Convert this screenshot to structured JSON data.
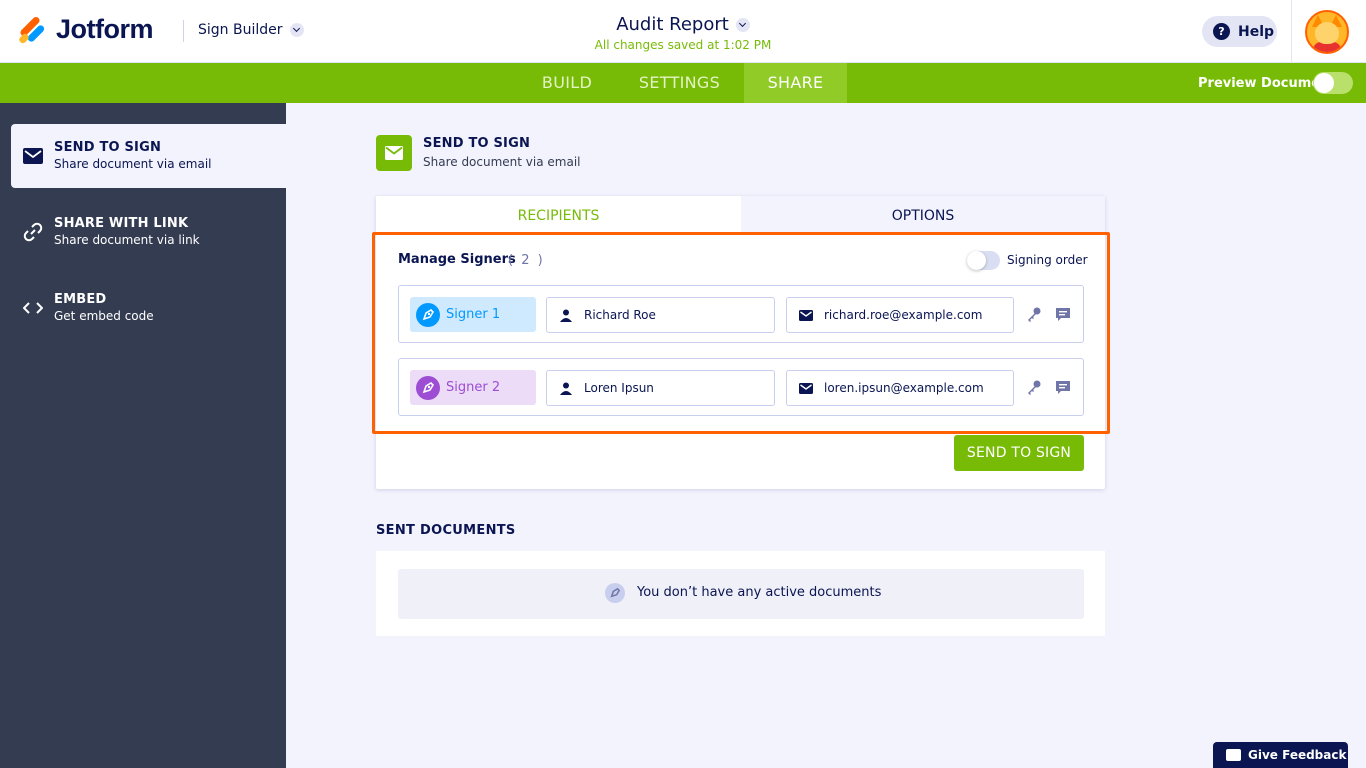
{
  "header": {
    "brand": "Jotform",
    "product": "Sign Builder",
    "doc_title": "Audit Report",
    "saved_status": "All changes saved at 1:02 PM",
    "help_label": "Help"
  },
  "nav": {
    "tabs": [
      {
        "label": "BUILD",
        "active": false
      },
      {
        "label": "SETTINGS",
        "active": false
      },
      {
        "label": "SHARE",
        "active": true
      }
    ],
    "preview_label": "Preview Document",
    "preview_on": false
  },
  "sidebar": {
    "items": [
      {
        "title": "SEND TO SIGN",
        "subtitle": "Share document via email",
        "icon": "envelope-icon",
        "active": true
      },
      {
        "title": "SHARE WITH LINK",
        "subtitle": "Share document via link",
        "icon": "link-icon",
        "active": false
      },
      {
        "title": "EMBED",
        "subtitle": "Get embed code",
        "icon": "code-icon",
        "active": false
      }
    ]
  },
  "section": {
    "title": "SEND TO SIGN",
    "subtitle": "Share document via email"
  },
  "card": {
    "tabs": [
      {
        "label": "RECIPIENTS",
        "active": true
      },
      {
        "label": "OPTIONS",
        "active": false
      }
    ],
    "manage_label": "Manage Signers",
    "signer_count": "( 2 )",
    "signing_order_label": "Signing order",
    "signing_order_on": false,
    "signers": [
      {
        "label": "Signer 1",
        "name": "Richard Roe",
        "email": "richard.roe@example.com",
        "color": "#0099ff",
        "bg": "#cfeaff"
      },
      {
        "label": "Signer 2",
        "name": "Loren Ipsun",
        "email": "loren.ipsun@example.com",
        "color": "#9c4dd3",
        "bg": "#ecdcf7"
      }
    ],
    "send_button": "SEND TO SIGN"
  },
  "sent": {
    "title": "SENT DOCUMENTS",
    "empty_text": "You don’t have any active documents"
  },
  "feedback_label": "Give Feedback",
  "colors": {
    "accent": "#78bb07",
    "navy": "#0a1551",
    "sidebar": "#343c52",
    "highlight": "#ff6100"
  }
}
